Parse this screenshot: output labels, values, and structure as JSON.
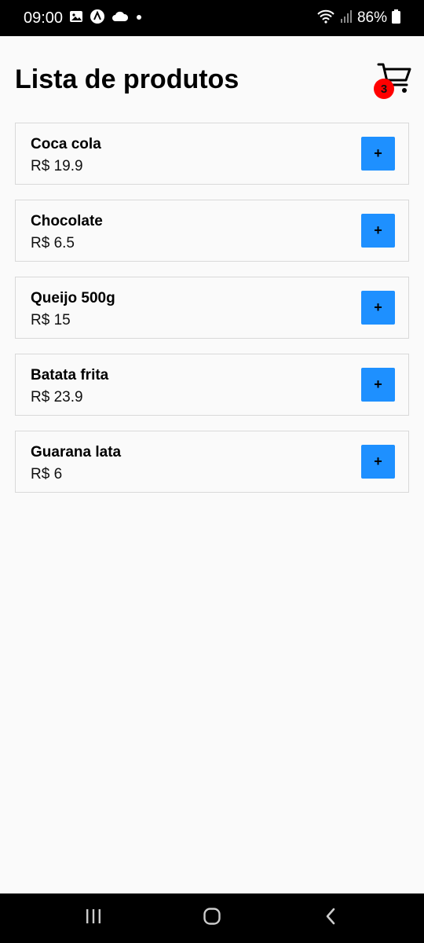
{
  "status_bar": {
    "time": "09:00",
    "battery": "86%",
    "icons": [
      "image-icon",
      "app-a-icon",
      "cloud-icon",
      "dot-icon",
      "wifi-icon",
      "signal-icon",
      "battery-icon"
    ]
  },
  "header": {
    "title": "Lista de produtos",
    "cart_count": "3"
  },
  "products": [
    {
      "name": "Coca cola",
      "price": "R$ 19.9",
      "add_label": "+"
    },
    {
      "name": "Chocolate",
      "price": "R$ 6.5",
      "add_label": "+"
    },
    {
      "name": "Queijo 500g",
      "price": "R$ 15",
      "add_label": "+"
    },
    {
      "name": "Batata frita",
      "price": "R$ 23.9",
      "add_label": "+"
    },
    {
      "name": "Guarana lata",
      "price": "R$ 6",
      "add_label": "+"
    }
  ],
  "colors": {
    "accent": "#1e90ff",
    "badge": "#ff0000",
    "background": "#fafafa"
  },
  "nav_bar": {
    "icons": [
      "recent-apps-icon",
      "home-icon",
      "back-icon"
    ]
  }
}
